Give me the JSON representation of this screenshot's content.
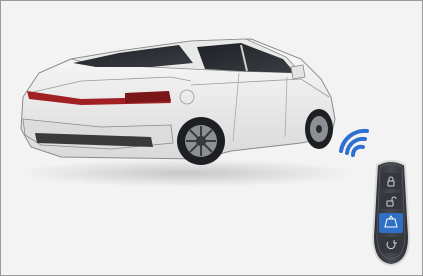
{
  "scene": {
    "subject": "car-icon",
    "key_fob": {
      "buttons": [
        {
          "icon": "lock-icon",
          "active": false
        },
        {
          "icon": "unlock-icon",
          "active": false
        },
        {
          "icon": "trunk-icon",
          "active": true
        },
        {
          "icon": "remote-start-icon",
          "active": false
        }
      ]
    },
    "signal": "wireless-signal-icon",
    "colors": {
      "background": "#f3f3f3",
      "car_body": "#f2f2f2",
      "glass": "#2b2e33",
      "taillight": "#a02024",
      "signal_blue": "#2e6fcf",
      "fob_body": "#3a3d42",
      "fob_active": "#2f6fc6"
    }
  }
}
